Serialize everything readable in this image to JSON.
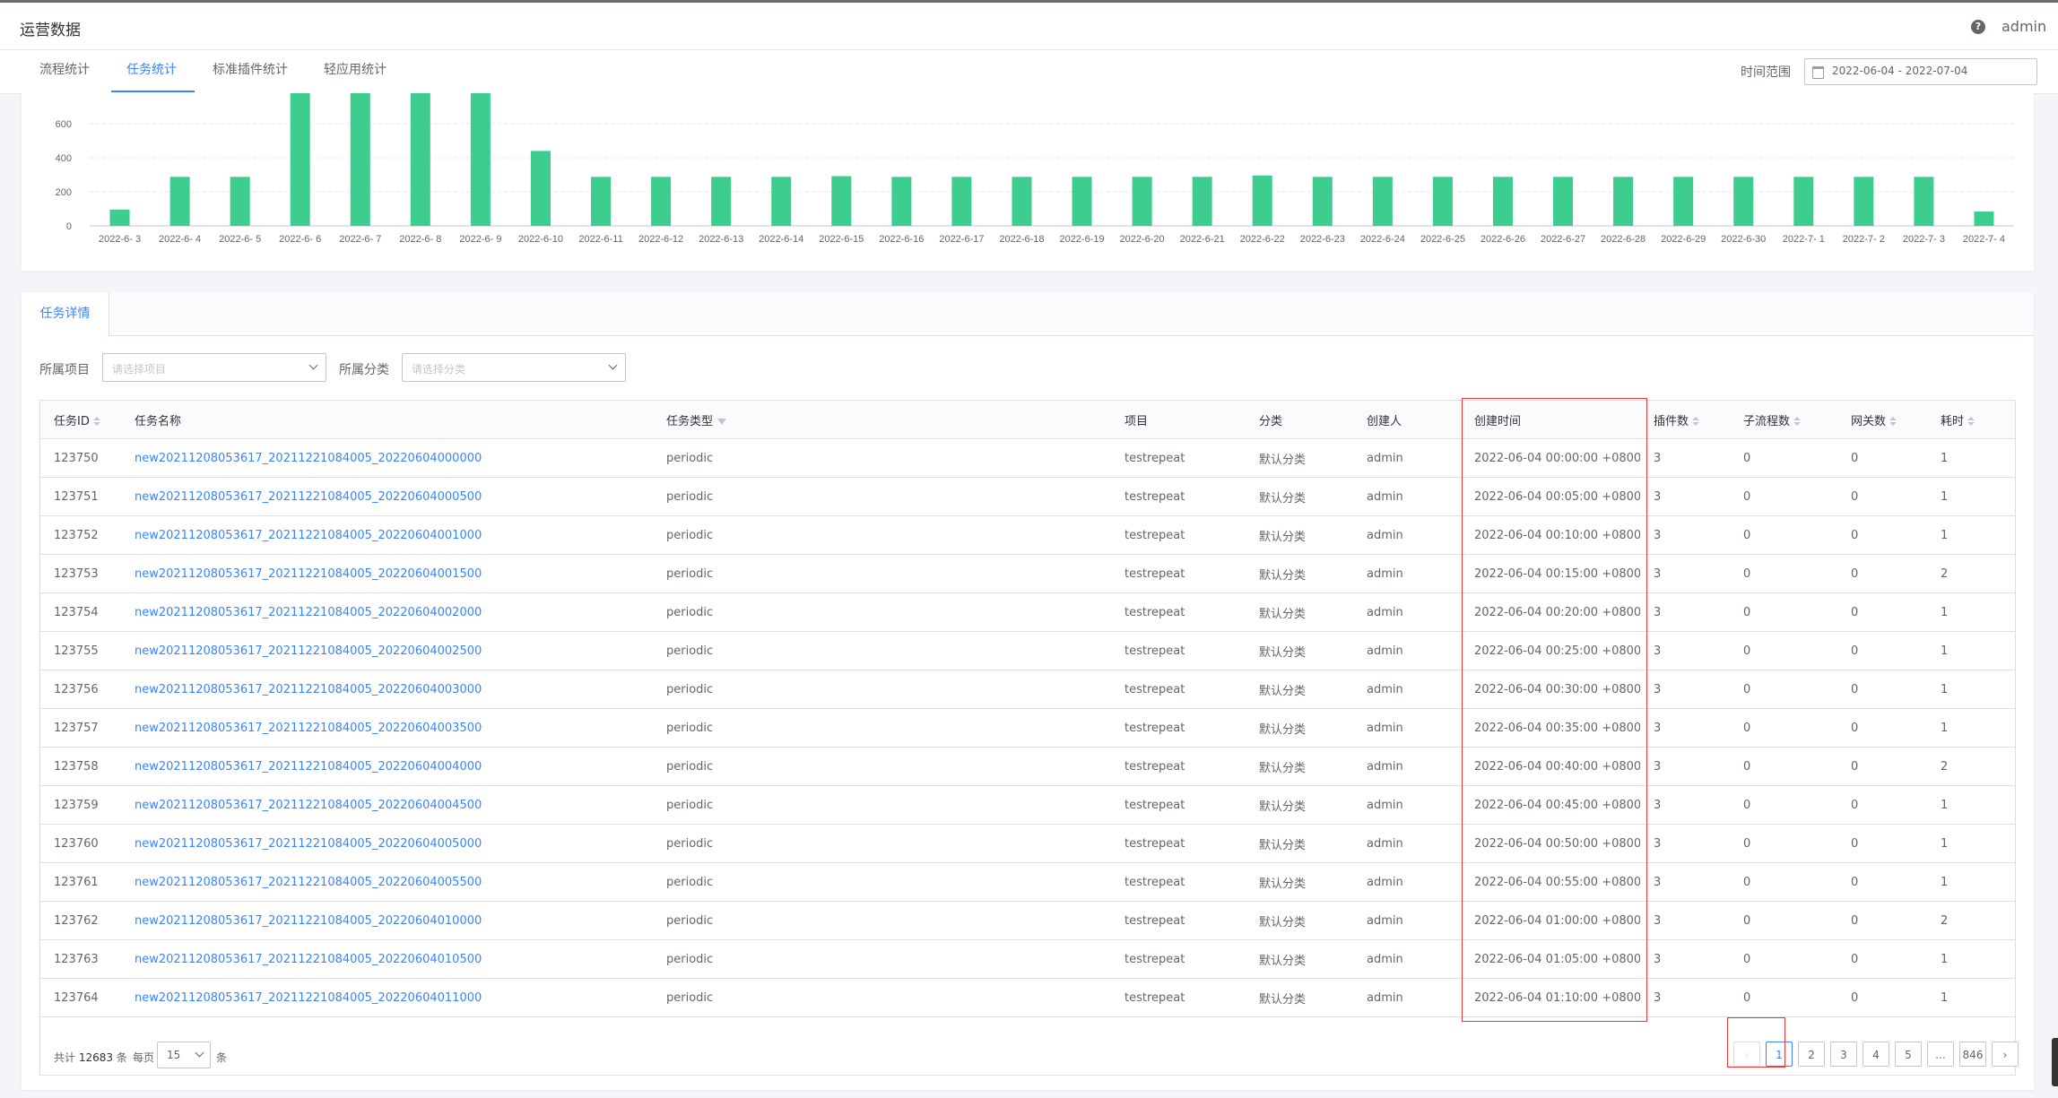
{
  "app": {
    "title": "运营数据",
    "user": "admin",
    "help_icon": "question-circle-icon"
  },
  "tabs": [
    {
      "label": "流程统计",
      "active": false
    },
    {
      "label": "任务统计",
      "active": true
    },
    {
      "label": "标准插件统计",
      "active": false
    },
    {
      "label": "轻应用统计",
      "active": false
    }
  ],
  "time_range": {
    "label": "时间范围",
    "value": "2022-06-04 - 2022-07-04",
    "icon": "calendar-icon"
  },
  "colors": {
    "accent": "#3a84ff",
    "bar": "#3dcd8f",
    "highlight": "#ea3636"
  },
  "chart_data": {
    "type": "bar",
    "categories": [
      "2022-6- 3",
      "2022-6- 4",
      "2022-6- 5",
      "2022-6- 6",
      "2022-6- 7",
      "2022-6- 8",
      "2022-6- 9",
      "2022-6-10",
      "2022-6-11",
      "2022-6-12",
      "2022-6-13",
      "2022-6-14",
      "2022-6-15",
      "2022-6-16",
      "2022-6-17",
      "2022-6-18",
      "2022-6-19",
      "2022-6-20",
      "2022-6-21",
      "2022-6-22",
      "2022-6-23",
      "2022-6-24",
      "2022-6-25",
      "2022-6-26",
      "2022-6-27",
      "2022-6-28",
      "2022-6-29",
      "2022-6-30",
      "2022-7- 1",
      "2022-7- 2",
      "2022-7- 3",
      "2022-7- 4"
    ],
    "values": [
      96,
      288,
      288,
      780,
      780,
      780,
      780,
      440,
      288,
      288,
      288,
      288,
      292,
      288,
      288,
      288,
      288,
      288,
      288,
      296,
      288,
      288,
      288,
      288,
      288,
      288,
      288,
      288,
      288,
      288,
      288,
      84
    ],
    "yticks": [
      0,
      200,
      400,
      600
    ],
    "ylim": [
      0,
      780
    ],
    "grid": true,
    "clipped_top": true
  },
  "detail": {
    "tab_label": "任务详情",
    "filters": [
      {
        "label": "所属项目",
        "placeholder": "请选择项目"
      },
      {
        "label": "所属分类",
        "placeholder": "请选择分类"
      }
    ],
    "columns": [
      {
        "label": "任务ID",
        "sortable": true
      },
      {
        "label": "任务名称"
      },
      {
        "label": "任务类型",
        "filterable": true
      },
      {
        "label": "项目"
      },
      {
        "label": "分类"
      },
      {
        "label": "创建人"
      },
      {
        "label": "创建时间"
      },
      {
        "label": "插件数",
        "sortable": true
      },
      {
        "label": "子流程数",
        "sortable": true
      },
      {
        "label": "网关数",
        "sortable": true
      },
      {
        "label": "耗时",
        "sortable": true
      }
    ],
    "rows": [
      [
        "123750",
        "new20211208053617_20211221084005_20220604000000",
        "periodic",
        "testrepeat",
        "默认分类",
        "admin",
        "2022-06-04 00:00:00 +0800",
        "3",
        "0",
        "0",
        "1"
      ],
      [
        "123751",
        "new20211208053617_20211221084005_20220604000500",
        "periodic",
        "testrepeat",
        "默认分类",
        "admin",
        "2022-06-04 00:05:00 +0800",
        "3",
        "0",
        "0",
        "1"
      ],
      [
        "123752",
        "new20211208053617_20211221084005_20220604001000",
        "periodic",
        "testrepeat",
        "默认分类",
        "admin",
        "2022-06-04 00:10:00 +0800",
        "3",
        "0",
        "0",
        "1"
      ],
      [
        "123753",
        "new20211208053617_20211221084005_20220604001500",
        "periodic",
        "testrepeat",
        "默认分类",
        "admin",
        "2022-06-04 00:15:00 +0800",
        "3",
        "0",
        "0",
        "2"
      ],
      [
        "123754",
        "new20211208053617_20211221084005_20220604002000",
        "periodic",
        "testrepeat",
        "默认分类",
        "admin",
        "2022-06-04 00:20:00 +0800",
        "3",
        "0",
        "0",
        "1"
      ],
      [
        "123755",
        "new20211208053617_20211221084005_20220604002500",
        "periodic",
        "testrepeat",
        "默认分类",
        "admin",
        "2022-06-04 00:25:00 +0800",
        "3",
        "0",
        "0",
        "1"
      ],
      [
        "123756",
        "new20211208053617_20211221084005_20220604003000",
        "periodic",
        "testrepeat",
        "默认分类",
        "admin",
        "2022-06-04 00:30:00 +0800",
        "3",
        "0",
        "0",
        "1"
      ],
      [
        "123757",
        "new20211208053617_20211221084005_20220604003500",
        "periodic",
        "testrepeat",
        "默认分类",
        "admin",
        "2022-06-04 00:35:00 +0800",
        "3",
        "0",
        "0",
        "1"
      ],
      [
        "123758",
        "new20211208053617_20211221084005_20220604004000",
        "periodic",
        "testrepeat",
        "默认分类",
        "admin",
        "2022-06-04 00:40:00 +0800",
        "3",
        "0",
        "0",
        "2"
      ],
      [
        "123759",
        "new20211208053617_20211221084005_20220604004500",
        "periodic",
        "testrepeat",
        "默认分类",
        "admin",
        "2022-06-04 00:45:00 +0800",
        "3",
        "0",
        "0",
        "1"
      ],
      [
        "123760",
        "new20211208053617_20211221084005_20220604005000",
        "periodic",
        "testrepeat",
        "默认分类",
        "admin",
        "2022-06-04 00:50:00 +0800",
        "3",
        "0",
        "0",
        "1"
      ],
      [
        "123761",
        "new20211208053617_20211221084005_20220604005500",
        "periodic",
        "testrepeat",
        "默认分类",
        "admin",
        "2022-06-04 00:55:00 +0800",
        "3",
        "0",
        "0",
        "1"
      ],
      [
        "123762",
        "new20211208053617_20211221084005_20220604010000",
        "periodic",
        "testrepeat",
        "默认分类",
        "admin",
        "2022-06-04 01:00:00 +0800",
        "3",
        "0",
        "0",
        "2"
      ],
      [
        "123763",
        "new20211208053617_20211221084005_20220604010500",
        "periodic",
        "testrepeat",
        "默认分类",
        "admin",
        "2022-06-04 01:05:00 +0800",
        "3",
        "0",
        "0",
        "1"
      ],
      [
        "123764",
        "new20211208053617_20211221084005_20220604011000",
        "periodic",
        "testrepeat",
        "默认分类",
        "admin",
        "2022-06-04 01:10:00 +0800",
        "3",
        "0",
        "0",
        "1"
      ]
    ],
    "pagination": {
      "total_prefix": "共计",
      "total": "12683",
      "total_suffix": "条",
      "per_page_label": "每页",
      "per_page": "15",
      "per_page_unit": "条",
      "pages": [
        "1",
        "2",
        "3",
        "4",
        "5",
        "...",
        "846"
      ],
      "current": "1",
      "prev_icon": "chevron-left-icon",
      "next_icon": "chevron-right-icon"
    }
  }
}
